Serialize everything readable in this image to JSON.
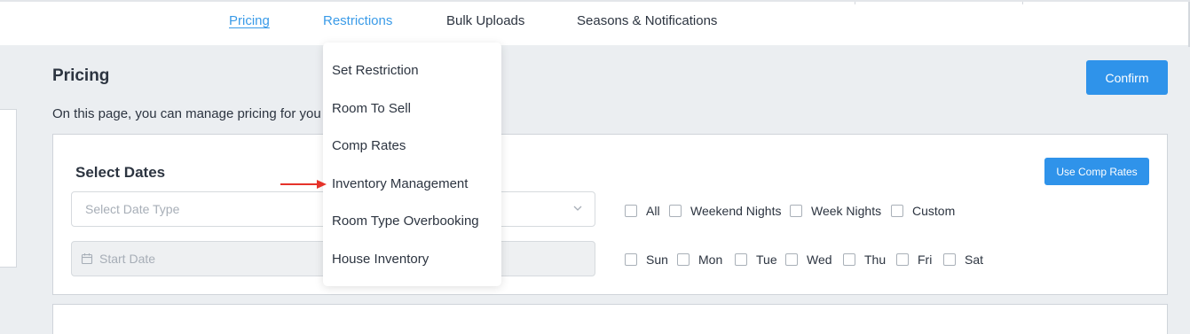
{
  "nav": {
    "tabs": [
      {
        "label": "Pricing",
        "state": "active"
      },
      {
        "label": "Restrictions",
        "state": "hover"
      },
      {
        "label": "Bulk Uploads",
        "state": "normal"
      },
      {
        "label": "Seasons & Notifications",
        "state": "normal"
      }
    ]
  },
  "dropdown": {
    "items": [
      "Set Restriction",
      "Room To Sell",
      "Comp Rates",
      "Inventory Management",
      "Room Type Overbooking",
      "House Inventory"
    ],
    "highlighted_item": "Inventory Management"
  },
  "page": {
    "title": "Pricing",
    "description": "On this page, you can manage pricing for you",
    "confirm_label": "Confirm"
  },
  "select_dates": {
    "title": "Select Dates",
    "comp_rates_label": "Use Comp Rates",
    "date_type_placeholder": "Select Date Type",
    "start_date_placeholder": "Start Date",
    "night_options": [
      "All",
      "Weekend Nights",
      "Week Nights",
      "Custom"
    ],
    "day_options": [
      "Sun",
      "Mon",
      "Tue",
      "Wed",
      "Thu",
      "Fri",
      "Sat"
    ]
  },
  "colors": {
    "accent": "#2f93ea",
    "link": "#3a9be8",
    "annotation_arrow": "#e5332a",
    "background": "#ebeef1"
  },
  "icons": {
    "date_type": "chevron-down-icon",
    "start_date": "calendar-icon",
    "annotation": "red-arrow-icon"
  }
}
